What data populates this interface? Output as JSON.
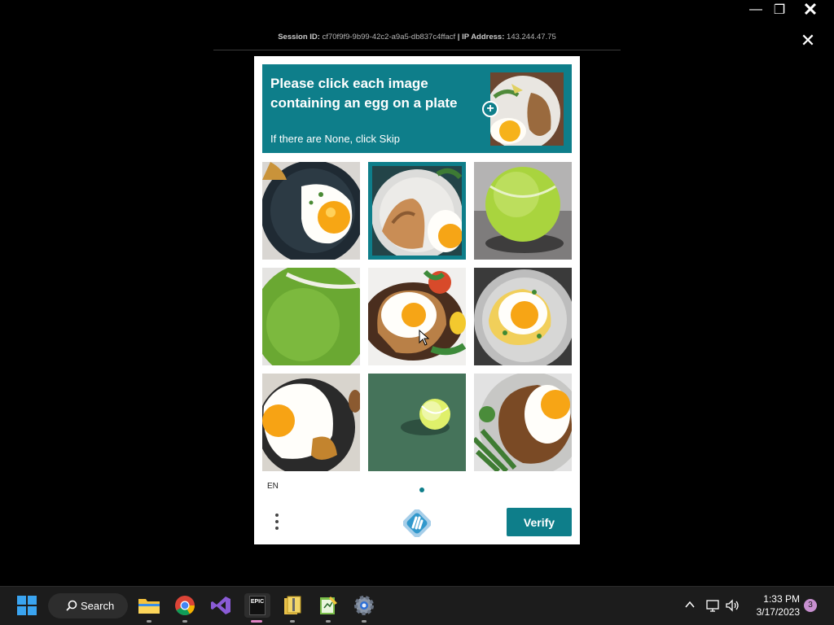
{
  "window": {
    "minimize_glyph": "—",
    "maximize_glyph": "❐",
    "close_glyph": "✕"
  },
  "session": {
    "id_label": "Session ID:",
    "id_value": "cf70f9f9-9b99-42c2-a9a5-db837c4ffacf",
    "separator": "|",
    "ip_label": "IP Address:",
    "ip_value": "143.244.47.75"
  },
  "overlay_close_glyph": "✕",
  "captcha": {
    "prompt": "Please click each image containing an egg on a plate",
    "skip_hint": "If there are None, click Skip",
    "plus_glyph": "+",
    "tiles": [
      {
        "content": "egg-on-plate",
        "selected": false
      },
      {
        "content": "egg-on-toast-plate",
        "selected": true
      },
      {
        "content": "tennis-ball",
        "selected": false
      },
      {
        "content": "tennis-ball",
        "selected": false
      },
      {
        "content": "egg-on-plate",
        "selected": false
      },
      {
        "content": "egg-on-plate",
        "selected": false
      },
      {
        "content": "egg-on-plate",
        "selected": false
      },
      {
        "content": "tennis-ball",
        "selected": false
      },
      {
        "content": "egg-on-plate",
        "selected": false
      }
    ],
    "language": "EN",
    "verify_label": "Verify",
    "accent_color": "#0e7e8a"
  },
  "taskbar": {
    "search_label": "Search",
    "apps": [
      "start-icon",
      "file-explorer-icon",
      "chrome-icon",
      "visual-studio-icon",
      "epic-games-icon",
      "archive-icon",
      "notepad-icon",
      "settings-icon"
    ],
    "epic_text": "EPIC",
    "time": "1:33 PM",
    "date": "3/17/2023",
    "notification_count": "3"
  }
}
